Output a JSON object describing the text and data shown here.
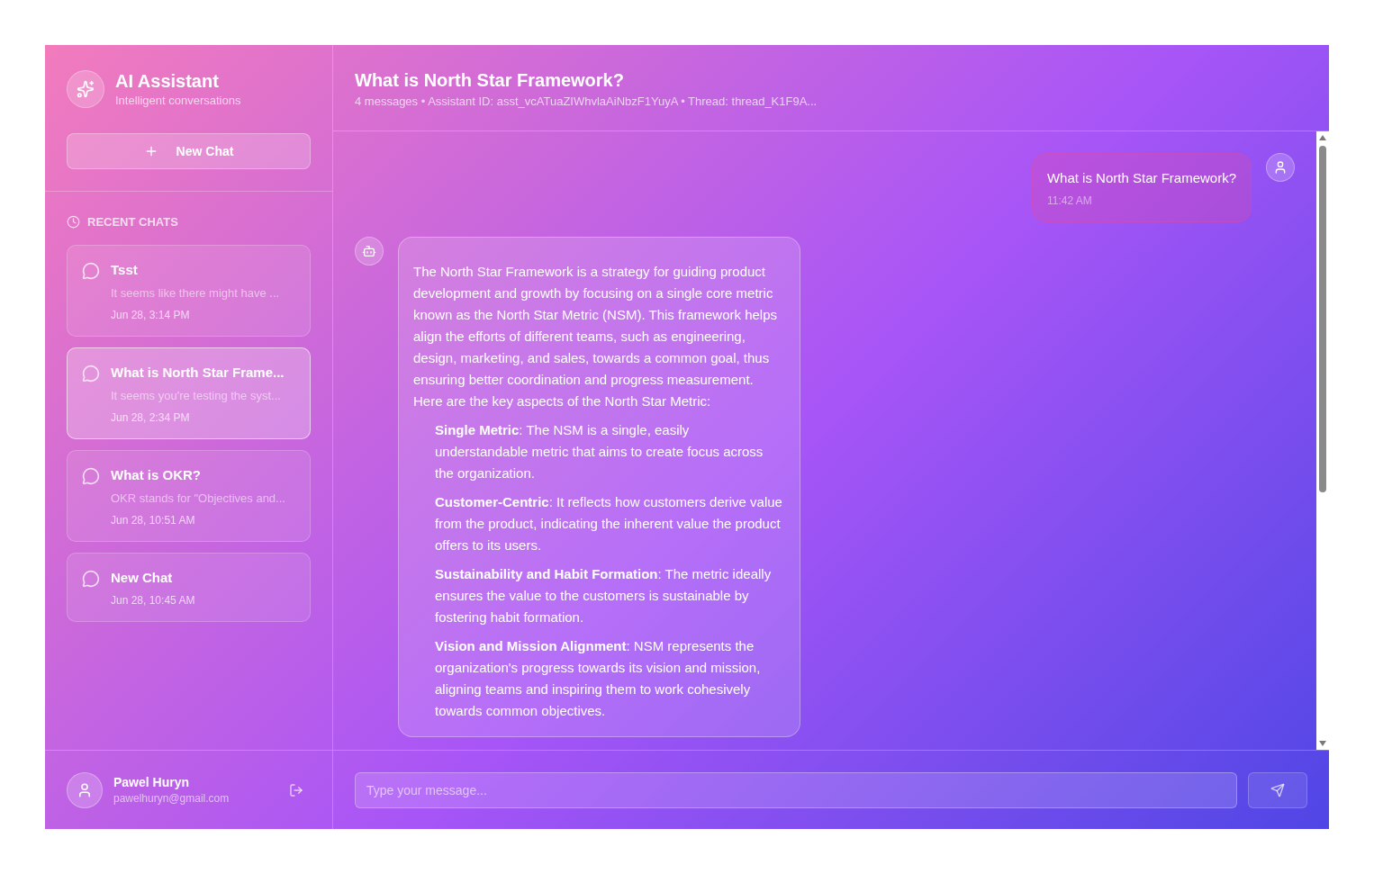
{
  "sidebar": {
    "app_title": "AI Assistant",
    "app_subtitle": "Intelligent conversations",
    "new_chat_button": "New Chat",
    "recent_heading": "RECENT CHATS",
    "chats": [
      {
        "title": "Tsst",
        "preview": "It seems like there might have ...",
        "time": "Jun 28, 3:14 PM",
        "selected": false
      },
      {
        "title": "What is North Star Frame...",
        "preview": "It seems you're testing the syst...",
        "time": "Jun 28, 2:34 PM",
        "selected": true
      },
      {
        "title": "What is OKR?",
        "preview": "OKR stands for \"Objectives and...",
        "time": "Jun 28, 10:51 AM",
        "selected": false
      },
      {
        "title": "New Chat",
        "time": "Jun 28, 10:45 AM",
        "selected": false
      }
    ],
    "user": {
      "name": "Pawel Huryn",
      "email": "pawelhuryn@gmail.com"
    }
  },
  "chat": {
    "title": "What is North Star Framework?",
    "meta": "4 messages • Assistant ID: asst_vcATuaZIWhvlaAiNbzF1YuyA • Thread: thread_K1F9A...",
    "messages": [
      {
        "kind": "user",
        "text": "What is North Star Framework?",
        "time": "11:42 AM"
      },
      {
        "kind": "assistant",
        "paragraph": "The North Star Framework is a strategy for guiding product development and growth by focusing on a single core metric known as the North Star Metric (NSM). This framework helps align the efforts of different teams, such as engineering, design, marketing, and sales, towards a common goal, thus ensuring better coordination and progress measurement. Here are the key aspects of the North Star Metric:",
        "items": [
          "**Single Metric**: The NSM is a single, easily understandable metric that aims to create focus across the organization.",
          "**Customer-Centric**: It reflects how customers derive value from the product, indicating the inherent value the product offers to its users.",
          "**Sustainability and Habit Formation**: The metric ideally ensures the value to the customers is sustainable by fostering habit formation.",
          "**Vision and Mission Alignment**: NSM represents the organization's progress towards its vision and mission, aligning teams and inspiring them to work cohesively towards common objectives."
        ]
      }
    ],
    "input": {
      "placeholder": "Type your message..."
    }
  }
}
